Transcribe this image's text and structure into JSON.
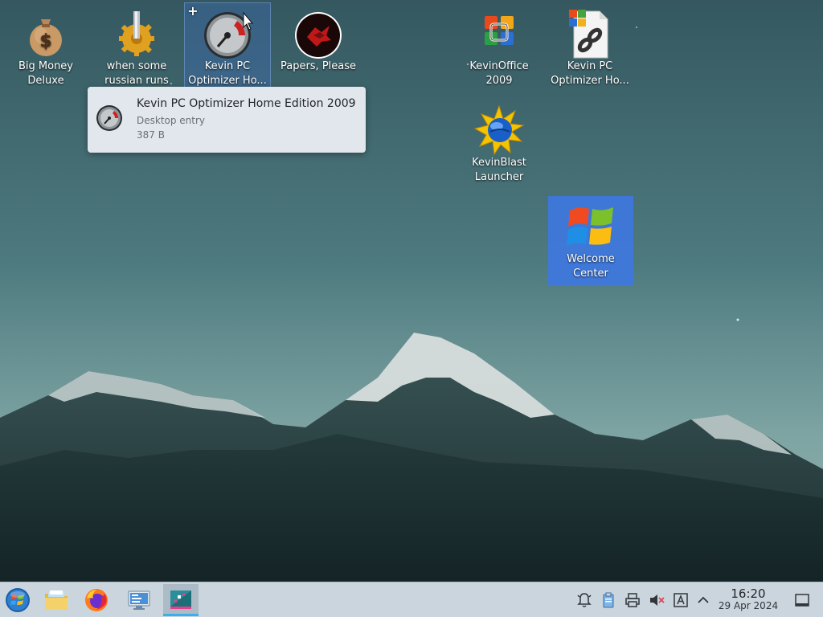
{
  "desktop": {
    "icons": [
      {
        "label": "Big Money Deluxe",
        "icon": "money-bag-icon"
      },
      {
        "label": "when some russian runs a...",
        "icon": "gear-icon"
      },
      {
        "label": "Kevin PC Optimizer Ho...",
        "icon": "speedometer-icon"
      },
      {
        "label": "Papers, Please",
        "icon": "papers-please-icon"
      },
      {
        "label": "KevinOffice 2009",
        "icon": "office-logo-icon"
      },
      {
        "label": "Kevin PC Optimizer Ho...",
        "icon": "link-document-icon"
      },
      {
        "label": "KevinBlast Launcher",
        "icon": "globe-starburst-icon"
      },
      {
        "label": "Welcome Center",
        "icon": "windows-flag-icon"
      }
    ]
  },
  "tooltip": {
    "title": "Kevin PC Optimizer Home Edition 2009",
    "type": "Desktop entry",
    "size": "387 B"
  },
  "taskbar": {
    "launchers": [
      {
        "icon": "start-orb-icon"
      },
      {
        "icon": "file-manager-icon"
      },
      {
        "icon": "firefox-icon"
      },
      {
        "icon": "system-settings-icon"
      },
      {
        "icon": "discover-app-icon"
      }
    ],
    "tray": [
      {
        "icon": "notifications-icon"
      },
      {
        "icon": "clipboard-icon"
      },
      {
        "icon": "printer-icon"
      },
      {
        "icon": "volume-muted-icon"
      },
      {
        "icon": "input-method-icon"
      },
      {
        "icon": "expand-tray-icon"
      }
    ],
    "clock": {
      "time": "16:20",
      "date": "29 Apr 2024"
    },
    "show_desktop_icon": "show-desktop-icon"
  },
  "colors": {
    "taskbar": "#cbd5dd",
    "selection": "#3d78e4",
    "tooltip_bg": "#e8ecf1",
    "sky_top": "#3d5f68"
  }
}
